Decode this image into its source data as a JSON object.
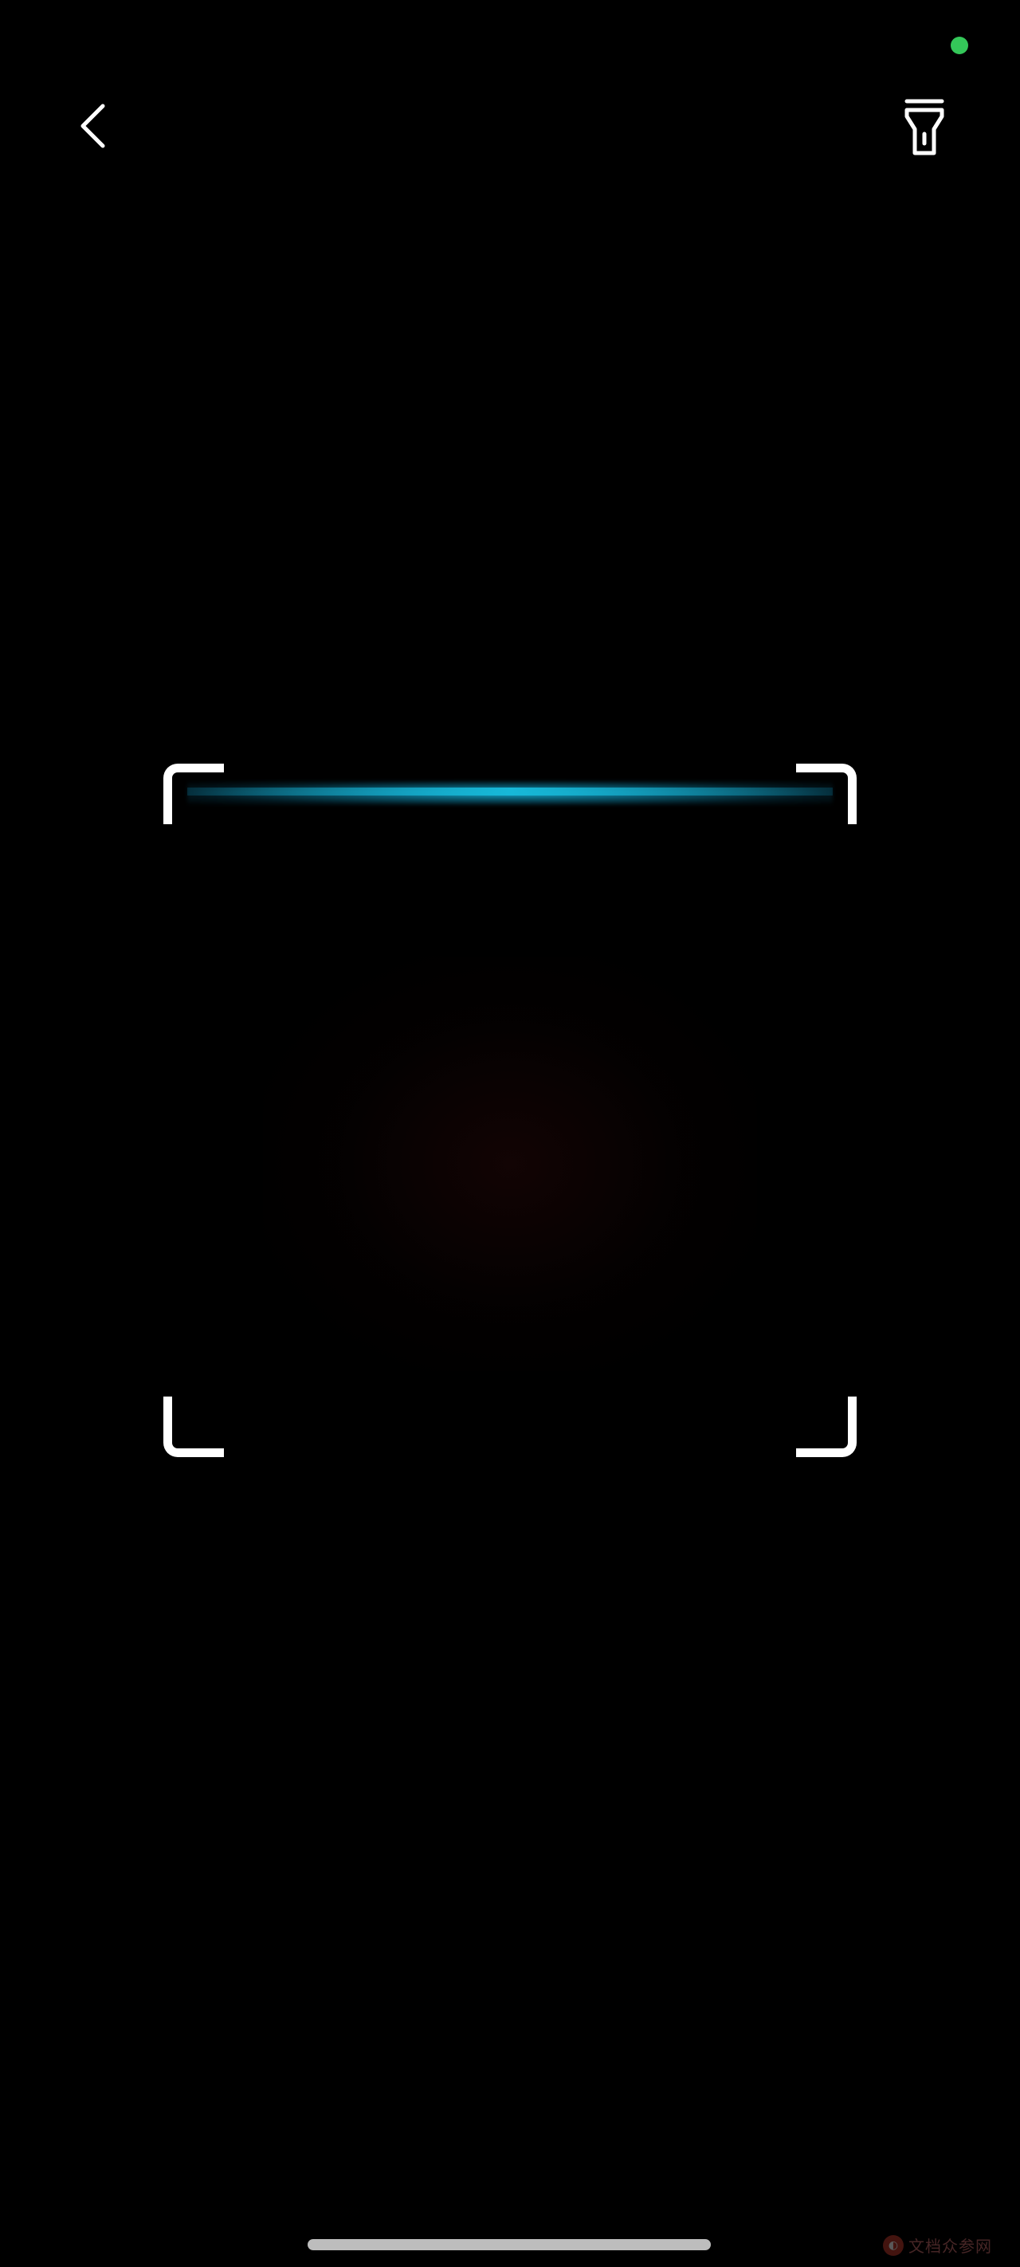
{
  "app": {
    "screen": "qr-scanner"
  },
  "toolbar": {
    "back_icon": "chevron-left-icon",
    "flash_icon": "flashlight-icon"
  },
  "status": {
    "indicator_color": "#34c759"
  },
  "scanner": {
    "line_color": "#17b8d8",
    "corner_color": "#ffffff"
  },
  "watermark": {
    "text": "文档众参网",
    "logo_icon": "logo-icon"
  }
}
